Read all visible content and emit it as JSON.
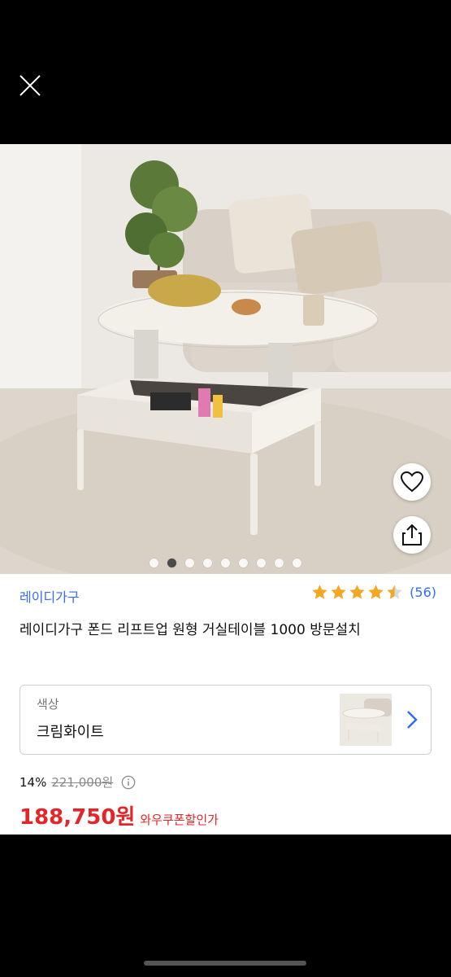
{
  "product": {
    "brand": "레이디가구",
    "rating": 4.5,
    "review_count": "(56)",
    "title": "레이디가구 폰드 리프트업 원형 거실테이블 1000 방문설치"
  },
  "option": {
    "label": "색상",
    "value": "크림화이트"
  },
  "pricing": {
    "discount": "14%",
    "original_price": "221,000원",
    "sale_price": "188,750원",
    "coupon_text": "와우쿠폰할인가"
  },
  "carousel": {
    "total": 9,
    "active_index": 1
  },
  "colors": {
    "accent_blue": "#346aff",
    "price_red": "#e52528",
    "star": "#f5a623"
  },
  "icons": [
    "close-icon",
    "heart-icon",
    "share-icon",
    "star-icon",
    "chevron-right-icon",
    "info-icon"
  ]
}
